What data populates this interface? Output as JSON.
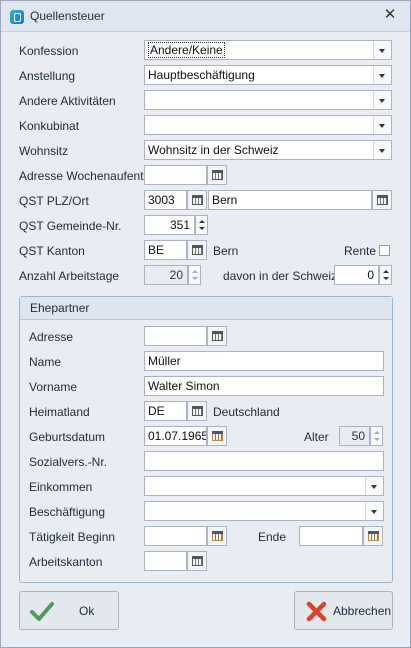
{
  "window": {
    "title": "Quellensteuer"
  },
  "form": {
    "konfession": {
      "label": "Konfession",
      "value": "Andere/Keine"
    },
    "anstellung": {
      "label": "Anstellung",
      "value": "Hauptbeschäftigung"
    },
    "andere_aktivitaeten": {
      "label": "Andere Aktivitäten",
      "value": ""
    },
    "konkubinat": {
      "label": "Konkubinat",
      "value": ""
    },
    "wohnsitz": {
      "label": "Wohnsitz",
      "value": "Wohnsitz in der Schweiz"
    },
    "adresse_wochenaufenthalt": {
      "label": "Adresse Wochenaufenth.",
      "value": ""
    },
    "qst_plz_ort": {
      "label": "QST PLZ/Ort",
      "plz": "3003",
      "ort": "Bern"
    },
    "qst_gemeinde_nr": {
      "label": "QST Gemeinde-Nr.",
      "value": "351"
    },
    "qst_kanton": {
      "label": "QST Kanton",
      "code": "BE",
      "name": "Bern"
    },
    "rente": {
      "label": "Rente",
      "checked": false
    },
    "anzahl_arbeitstage": {
      "label": "Anzahl Arbeitstage",
      "value": "20"
    },
    "davon_schweiz": {
      "label": "davon in der Schweiz",
      "value": "0"
    }
  },
  "ehepartner": {
    "header": "Ehepartner",
    "adresse": {
      "label": "Adresse",
      "value": ""
    },
    "name": {
      "label": "Name",
      "value": "Müller"
    },
    "vorname": {
      "label": "Vorname",
      "value": "Walter Simon"
    },
    "heimatland": {
      "label": "Heimatland",
      "code": "DE",
      "name": "Deutschland"
    },
    "geburtsdatum": {
      "label": "Geburtsdatum",
      "value": "01.07.1965"
    },
    "alter": {
      "label": "Alter",
      "value": "50"
    },
    "sozialvers_nr": {
      "label": "Sozialvers.-Nr.",
      "value": ""
    },
    "einkommen": {
      "label": "Einkommen",
      "value": ""
    },
    "beschaeftigung": {
      "label": "Beschäftigung",
      "value": ""
    },
    "taetigkeit_beginn": {
      "label": "Tätigkeit Beginn",
      "value": ""
    },
    "ende": {
      "label": "Ende",
      "value": ""
    },
    "arbeitskanton": {
      "label": "Arbeitskanton",
      "value": ""
    }
  },
  "buttons": {
    "ok": "Ok",
    "abbrechen": "Abbrechen"
  },
  "colors": {
    "ok_check": "#4f9a5e",
    "cancel_x": "#d9432c",
    "accent": "#1478b8"
  }
}
